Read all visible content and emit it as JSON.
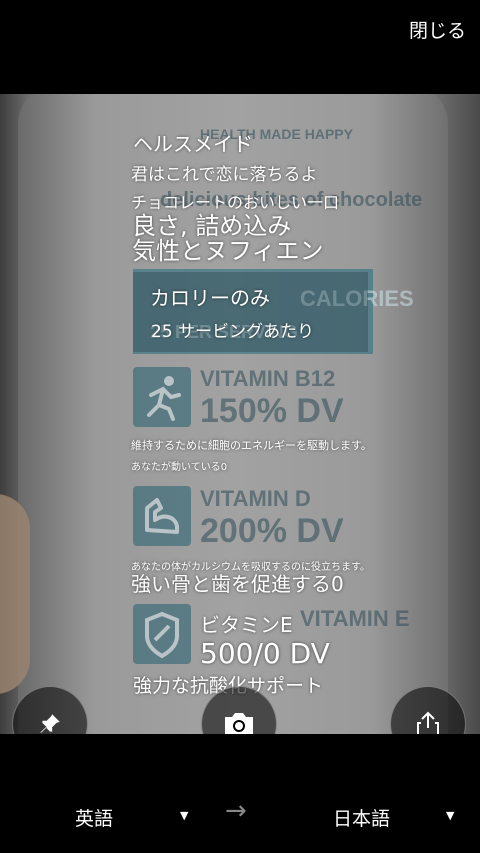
{
  "header": {
    "close_label": "閉じる"
  },
  "background_text": {
    "brand": "HEALTH MADE HAPPY",
    "headline": "delicious bites of chocolate",
    "panel": "CALORIES",
    "panel_sub": "25 PER SERVING",
    "vitamin_b12": "VITAMIN B12",
    "b12_dv": "150% DV",
    "vitamin_d": "VITAMIN D",
    "d_dv": "200% DV",
    "vitamin_e": "VITAMIN E"
  },
  "translation": {
    "line1": "ヘルスメイド",
    "line2": "君はこれで恋に落ちるよ",
    "line3": "チョコレートのおいしい一口",
    "line4": "良さ, 詰め込み",
    "line5": "気性とヌフィエン",
    "line6": "カロリーのみ",
    "line7": "25 サービングあたり",
    "line8": "維持するために細胞のエネルギーを駆動します。",
    "line9": "あなたが動いている0",
    "line10": "あなたの体がカルシウムを吸収するのに役立ちます。",
    "line11": "強い骨と歯を促進する0",
    "line12": "ビタミンE",
    "line13": "500/0 DV",
    "line14": "強力な抗酸化サポート"
  },
  "icons": {
    "pin": "pin-icon",
    "camera": "camera-icon",
    "share": "share-icon",
    "runner": "runner-icon",
    "muscle": "muscle-icon",
    "shield": "shield-icon"
  },
  "footer": {
    "source_lang": "英語",
    "target_lang": "日本語",
    "arrow": "→",
    "caret": "▼"
  }
}
